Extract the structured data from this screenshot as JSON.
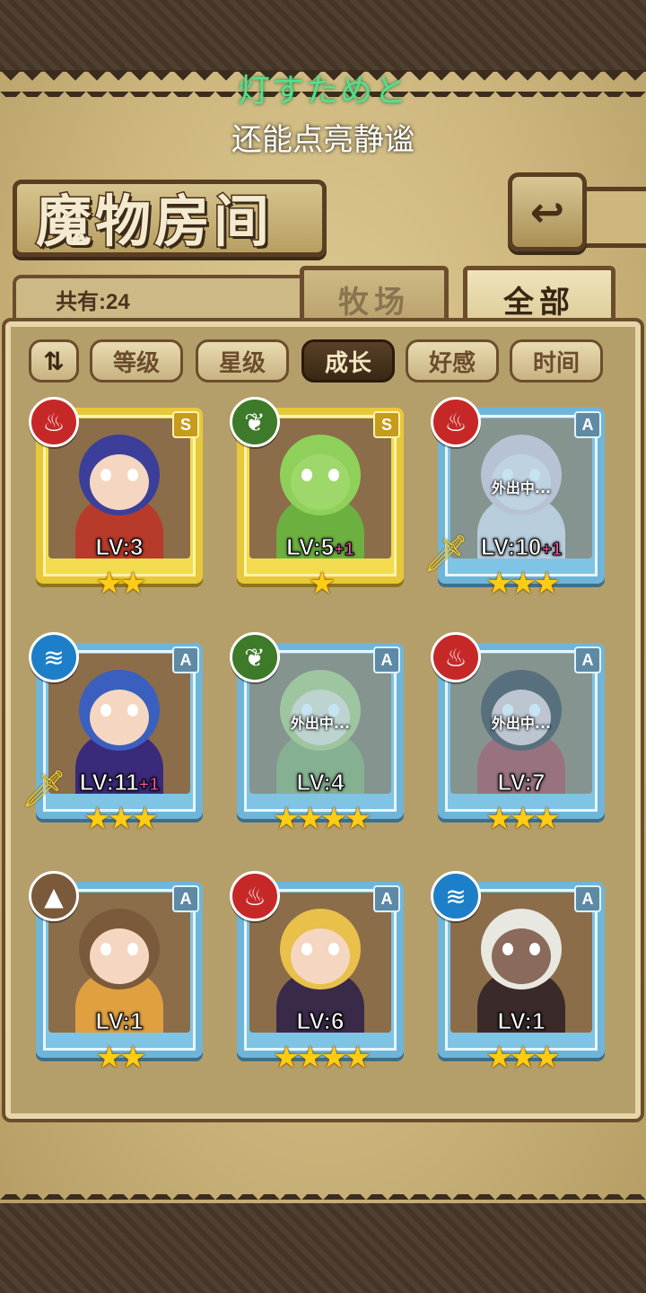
{
  "subtitle": {
    "line1": "灯すためと",
    "line2": "还能点亮静谧"
  },
  "header": {
    "title": "魔物房间",
    "back_icon": "back-arrow-icon"
  },
  "summary": {
    "count_label": "共有:24"
  },
  "tabs": [
    {
      "label": "牧场",
      "active": false
    },
    {
      "label": "全部",
      "active": true
    }
  ],
  "sort": {
    "toggle_icon": "sort-toggle-icon",
    "buttons": [
      {
        "label": "等级",
        "active": false
      },
      {
        "label": "星级",
        "active": false
      },
      {
        "label": "成长",
        "active": true
      },
      {
        "label": "好感",
        "active": false
      },
      {
        "label": "时间",
        "active": false
      }
    ]
  },
  "monsters": [
    {
      "rank": "S",
      "element": "fire",
      "level": "LV:3",
      "bonus": "",
      "stars": "★★",
      "away": false,
      "weapon": false
    },
    {
      "rank": "S",
      "element": "leaf",
      "level": "LV:5",
      "bonus": "+1",
      "stars": "★",
      "away": false,
      "weapon": false
    },
    {
      "rank": "A",
      "element": "fire",
      "level": "LV:10",
      "bonus": "+1",
      "stars": "★★★",
      "away": true,
      "weapon": true
    },
    {
      "rank": "A",
      "element": "water",
      "level": "LV:11",
      "bonus": "+1",
      "stars": "★★★",
      "away": false,
      "weapon": true
    },
    {
      "rank": "A",
      "element": "leaf",
      "level": "LV:4",
      "bonus": "",
      "stars": "★★★★",
      "away": true,
      "weapon": false
    },
    {
      "rank": "A",
      "element": "fire",
      "level": "LV:7",
      "bonus": "",
      "stars": "★★★",
      "away": true,
      "weapon": false
    },
    {
      "rank": "A",
      "element": "earth",
      "level": "LV:1",
      "bonus": "",
      "stars": "★★",
      "away": false,
      "weapon": false
    },
    {
      "rank": "A",
      "element": "fire",
      "level": "LV:6",
      "bonus": "",
      "stars": "★★★★",
      "away": false,
      "weapon": false
    },
    {
      "rank": "A",
      "element": "water",
      "level": "LV:1",
      "bonus": "",
      "stars": "★★★",
      "away": false,
      "weapon": false
    }
  ],
  "away_label": "外出中...",
  "colors": {
    "fire": "#c62828",
    "leaf": "#3d7a2a",
    "water": "#1e7fc9",
    "earth": "#7a5a3a",
    "rank_s_frame": "#e7c83a",
    "rank_a_frame": "#6fb5d9"
  }
}
